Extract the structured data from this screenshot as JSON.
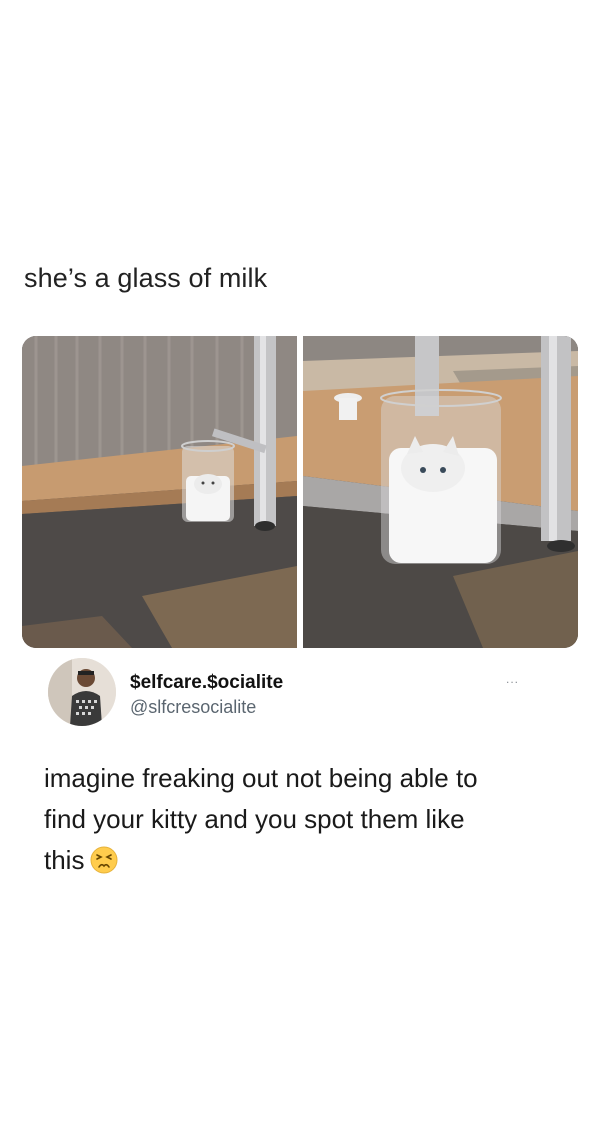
{
  "post": {
    "caption": "she’s a glass of milk"
  },
  "images": {
    "left_icon": "cat-in-glass-wide-photo",
    "right_icon": "cat-in-glass-closeup-photo"
  },
  "tweet": {
    "display_name": "$elfcare.$ocialite",
    "handle": "@slfcresocialite",
    "more_label": "...",
    "text_lines": [
      "imagine freaking out not being able to",
      "find your kitty and you spot them like",
      "this"
    ],
    "emoji": "persevering-face-emoji"
  }
}
